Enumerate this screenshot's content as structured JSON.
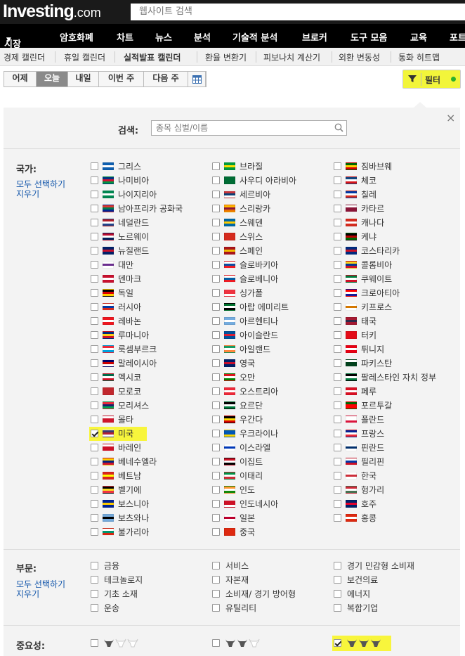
{
  "header": {
    "logo_text": "Investing",
    "logo_suffix": ".com",
    "search_placeholder": "웹사이트 검색"
  },
  "nav": [
    {
      "label": "시장",
      "has_caret": true
    },
    {
      "label": "암호화폐"
    },
    {
      "label": "차트"
    },
    {
      "label": "뉴스"
    },
    {
      "label": "분석"
    },
    {
      "label": "기술적 분석"
    },
    {
      "label": "브로커"
    },
    {
      "label": "도구 모음"
    },
    {
      "label": "교육"
    },
    {
      "label": "포트"
    }
  ],
  "subnav": [
    "경제 캘린더",
    "휴일 캘린더",
    "실적발표 캘린더",
    "환율 변환기",
    "피보나치 계산기",
    "외환 변동성",
    "통화 히트맵"
  ],
  "day_tabs": [
    {
      "label": "어제"
    },
    {
      "label": "오늘",
      "active": true
    },
    {
      "label": "내일"
    },
    {
      "label": "이번 주"
    },
    {
      "label": "다음 주"
    }
  ],
  "filter": {
    "label": "필터",
    "active": true
  },
  "search": {
    "label": "검색:",
    "placeholder": "종목 심벌/이름"
  },
  "country_section": {
    "title": "국가:",
    "select_all": "모두 선택하기",
    "clear": "지우기"
  },
  "countries": [
    [
      {
        "name": "그리스",
        "checked": false,
        "colors": [
          "#0d5eaf",
          "#ffffff",
          "#0d5eaf"
        ]
      },
      {
        "name": "나미비아",
        "checked": false,
        "colors": [
          "#003580",
          "#d21034",
          "#009543"
        ]
      },
      {
        "name": "나이지리아",
        "checked": false,
        "colors": [
          "#008751",
          "#ffffff",
          "#008751"
        ]
      },
      {
        "name": "남아프리카 공화국",
        "checked": false,
        "colors": [
          "#de3831",
          "#007a4d",
          "#002395"
        ]
      },
      {
        "name": "네덜란드",
        "checked": false,
        "colors": [
          "#ae1c28",
          "#ffffff",
          "#21468b"
        ]
      },
      {
        "name": "노르웨이",
        "checked": false,
        "colors": [
          "#ba0c2f",
          "#ffffff",
          "#00205b"
        ]
      },
      {
        "name": "뉴질랜드",
        "checked": false,
        "colors": [
          "#012169",
          "#c8102e",
          "#012169"
        ]
      },
      {
        "name": "대만",
        "checked": false,
        "colors": [
          "#ffffff",
          "#6b2d8f",
          "#ffffff"
        ]
      },
      {
        "name": "덴마크",
        "checked": false,
        "colors": [
          "#c8102e",
          "#ffffff",
          "#c8102e"
        ]
      },
      {
        "name": "독일",
        "checked": false,
        "colors": [
          "#000000",
          "#dd0000",
          "#ffce00"
        ]
      },
      {
        "name": "러시아",
        "checked": false,
        "colors": [
          "#ffffff",
          "#0039a6",
          "#d52b1e"
        ]
      },
      {
        "name": "레바논",
        "checked": false,
        "colors": [
          "#ee161f",
          "#ffffff",
          "#ee161f"
        ]
      },
      {
        "name": "루마니아",
        "checked": false,
        "colors": [
          "#002b7f",
          "#fcd116",
          "#ce1126"
        ]
      },
      {
        "name": "룩셈부르크",
        "checked": false,
        "colors": [
          "#ed2939",
          "#ffffff",
          "#00a1de"
        ]
      },
      {
        "name": "말레이시아",
        "checked": false,
        "colors": [
          "#010066",
          "#cc0001",
          "#ffffff"
        ]
      },
      {
        "name": "멕시코",
        "checked": false,
        "colors": [
          "#006847",
          "#ffffff",
          "#ce1126"
        ]
      },
      {
        "name": "모로코",
        "checked": false,
        "colors": [
          "#c1272d",
          "#c1272d",
          "#c1272d"
        ]
      },
      {
        "name": "모리셔스",
        "checked": false,
        "colors": [
          "#ea2839",
          "#1a206d",
          "#00a551"
        ]
      },
      {
        "name": "몰타",
        "checked": false,
        "colors": [
          "#ffffff",
          "#cf142b",
          "#cf142b"
        ]
      },
      {
        "name": "미국",
        "checked": true,
        "colors": [
          "#3c3b6e",
          "#b22234",
          "#ffffff"
        ]
      },
      {
        "name": "바레인",
        "checked": false,
        "colors": [
          "#ffffff",
          "#ce1126",
          "#ce1126"
        ]
      },
      {
        "name": "베네수엘라",
        "checked": false,
        "colors": [
          "#ffcc00",
          "#00247d",
          "#cf142b"
        ]
      },
      {
        "name": "베트남",
        "checked": false,
        "colors": [
          "#da251d",
          "#ffff00",
          "#da251d"
        ]
      },
      {
        "name": "벨기에",
        "checked": false,
        "colors": [
          "#000000",
          "#fdda24",
          "#ef3340"
        ]
      },
      {
        "name": "보스니아",
        "checked": false,
        "colors": [
          "#002395",
          "#fecb00",
          "#002395"
        ]
      },
      {
        "name": "보츠와나",
        "checked": false,
        "colors": [
          "#75aadb",
          "#000000",
          "#75aadb"
        ]
      },
      {
        "name": "불가리아",
        "checked": false,
        "colors": [
          "#ffffff",
          "#00966e",
          "#d62612"
        ]
      }
    ],
    [
      {
        "name": "브라질",
        "checked": false,
        "colors": [
          "#009c3b",
          "#ffdf00",
          "#009c3b"
        ]
      },
      {
        "name": "사우디 아라비아",
        "checked": false,
        "colors": [
          "#006c35",
          "#006c35",
          "#006c35"
        ]
      },
      {
        "name": "세르비아",
        "checked": false,
        "colors": [
          "#c6363c",
          "#0c4076",
          "#ffffff"
        ]
      },
      {
        "name": "스리랑카",
        "checked": false,
        "colors": [
          "#ffb700",
          "#8d153a",
          "#eb7400"
        ]
      },
      {
        "name": "스웨덴",
        "checked": false,
        "colors": [
          "#006aa7",
          "#fecc00",
          "#006aa7"
        ]
      },
      {
        "name": "스위스",
        "checked": false,
        "colors": [
          "#d52b1e",
          "#d52b1e",
          "#d52b1e"
        ]
      },
      {
        "name": "스페인",
        "checked": false,
        "colors": [
          "#aa151b",
          "#f1bf00",
          "#aa151b"
        ]
      },
      {
        "name": "슬로바키아",
        "checked": false,
        "colors": [
          "#ffffff",
          "#0b4ea2",
          "#ee1c25"
        ]
      },
      {
        "name": "슬로베니아",
        "checked": false,
        "colors": [
          "#ffffff",
          "#005da4",
          "#ed1c24"
        ]
      },
      {
        "name": "싱가폴",
        "checked": false,
        "colors": [
          "#ef3340",
          "#ef3340",
          "#ffffff"
        ]
      },
      {
        "name": "아랍 에미리트",
        "checked": false,
        "colors": [
          "#00732f",
          "#ffffff",
          "#000000"
        ]
      },
      {
        "name": "아르헨티나",
        "checked": false,
        "colors": [
          "#74acdf",
          "#ffffff",
          "#74acdf"
        ]
      },
      {
        "name": "아이슬란드",
        "checked": false,
        "colors": [
          "#02529c",
          "#dc1e35",
          "#02529c"
        ]
      },
      {
        "name": "아일랜드",
        "checked": false,
        "colors": [
          "#169b62",
          "#ffffff",
          "#ff883e"
        ]
      },
      {
        "name": "영국",
        "checked": false,
        "colors": [
          "#012169",
          "#c8102e",
          "#012169"
        ]
      },
      {
        "name": "오만",
        "checked": false,
        "colors": [
          "#db161b",
          "#ffffff",
          "#008000"
        ]
      },
      {
        "name": "오스트리아",
        "checked": false,
        "colors": [
          "#ed2939",
          "#ffffff",
          "#ed2939"
        ]
      },
      {
        "name": "요르단",
        "checked": false,
        "colors": [
          "#000000",
          "#ffffff",
          "#007a3d"
        ]
      },
      {
        "name": "우간다",
        "checked": false,
        "colors": [
          "#000000",
          "#fcdc04",
          "#d90000"
        ]
      },
      {
        "name": "우크라이나",
        "checked": false,
        "colors": [
          "#0057b7",
          "#0057b7",
          "#ffd700"
        ]
      },
      {
        "name": "이스라엘",
        "checked": false,
        "colors": [
          "#ffffff",
          "#0038b8",
          "#ffffff"
        ]
      },
      {
        "name": "이집트",
        "checked": false,
        "colors": [
          "#ce1126",
          "#ffffff",
          "#000000"
        ]
      },
      {
        "name": "이태리",
        "checked": false,
        "colors": [
          "#009246",
          "#ffffff",
          "#ce2b37"
        ]
      },
      {
        "name": "인도",
        "checked": false,
        "colors": [
          "#ff9933",
          "#ffffff",
          "#138808"
        ]
      },
      {
        "name": "인도네시아",
        "checked": false,
        "colors": [
          "#ce1126",
          "#ce1126",
          "#ffffff"
        ]
      },
      {
        "name": "일본",
        "checked": false,
        "colors": [
          "#ffffff",
          "#bc002d",
          "#ffffff"
        ]
      },
      {
        "name": "중국",
        "checked": false,
        "colors": [
          "#de2910",
          "#de2910",
          "#de2910"
        ]
      }
    ],
    [
      {
        "name": "짐바브웨",
        "checked": false,
        "colors": [
          "#006400",
          "#ffd200",
          "#d40000"
        ]
      },
      {
        "name": "체코",
        "checked": false,
        "colors": [
          "#11457e",
          "#ffffff",
          "#d7141a"
        ]
      },
      {
        "name": "칠레",
        "checked": false,
        "colors": [
          "#0039a6",
          "#ffffff",
          "#d52b1e"
        ]
      },
      {
        "name": "카타르",
        "checked": false,
        "colors": [
          "#ffffff",
          "#8a1538",
          "#8a1538"
        ]
      },
      {
        "name": "캐나다",
        "checked": false,
        "colors": [
          "#d52b1e",
          "#ffffff",
          "#d52b1e"
        ]
      },
      {
        "name": "케냐",
        "checked": false,
        "colors": [
          "#000000",
          "#bb0000",
          "#006600"
        ]
      },
      {
        "name": "코스타리카",
        "checked": false,
        "colors": [
          "#002b7f",
          "#ce1126",
          "#002b7f"
        ]
      },
      {
        "name": "콜롬비아",
        "checked": false,
        "colors": [
          "#fcd116",
          "#003893",
          "#ce1126"
        ]
      },
      {
        "name": "쿠웨이트",
        "checked": false,
        "colors": [
          "#007a3d",
          "#ffffff",
          "#ce1126"
        ]
      },
      {
        "name": "크로아티아",
        "checked": false,
        "colors": [
          "#ff0000",
          "#ffffff",
          "#171796"
        ]
      },
      {
        "name": "키프로스",
        "checked": false,
        "colors": [
          "#ffffff",
          "#d57800",
          "#ffffff"
        ]
      },
      {
        "name": "태국",
        "checked": false,
        "colors": [
          "#a51931",
          "#2d2a4a",
          "#a51931"
        ]
      },
      {
        "name": "터키",
        "checked": false,
        "colors": [
          "#e30a17",
          "#e30a17",
          "#e30a17"
        ]
      },
      {
        "name": "튀니지",
        "checked": false,
        "colors": [
          "#e70013",
          "#ffffff",
          "#e70013"
        ]
      },
      {
        "name": "파키스탄",
        "checked": false,
        "colors": [
          "#ffffff",
          "#01411c",
          "#01411c"
        ]
      },
      {
        "name": "팔레스타인 자치 정부",
        "checked": false,
        "colors": [
          "#000000",
          "#ffffff",
          "#007a3d"
        ]
      },
      {
        "name": "페루",
        "checked": false,
        "colors": [
          "#d91023",
          "#ffffff",
          "#d91023"
        ]
      },
      {
        "name": "포르투갈",
        "checked": false,
        "colors": [
          "#006600",
          "#ff0000",
          "#ff0000"
        ]
      },
      {
        "name": "폴란드",
        "checked": false,
        "colors": [
          "#ffffff",
          "#ffffff",
          "#dc143c"
        ]
      },
      {
        "name": "프랑스",
        "checked": false,
        "colors": [
          "#002395",
          "#ffffff",
          "#ed2939"
        ]
      },
      {
        "name": "핀란드",
        "checked": false,
        "colors": [
          "#ffffff",
          "#002f6c",
          "#ffffff"
        ]
      },
      {
        "name": "필리핀",
        "checked": false,
        "colors": [
          "#ffffff",
          "#0038a8",
          "#ce1126"
        ]
      },
      {
        "name": "한국",
        "checked": false,
        "colors": [
          "#ffffff",
          "#cd2e3a",
          "#ffffff"
        ]
      },
      {
        "name": "헝가리",
        "checked": false,
        "colors": [
          "#ce2939",
          "#ffffff",
          "#477050"
        ]
      },
      {
        "name": "호주",
        "checked": false,
        "colors": [
          "#012169",
          "#e4002b",
          "#012169"
        ]
      },
      {
        "name": "홍콩",
        "checked": false,
        "colors": [
          "#de2910",
          "#ffffff",
          "#de2910"
        ]
      }
    ]
  ],
  "sector_section": {
    "title": "부문:",
    "select_all": "모두 선택하기",
    "clear": "지우기"
  },
  "sectors": [
    [
      "금융",
      "테크놀로지",
      "기초 소재",
      "운송"
    ],
    [
      "서비스",
      "자본재",
      "소비재/ 경기 방어형",
      "유틸리티"
    ],
    [
      "경기 민감형 소비재",
      "보건의료",
      "에너지",
      "복합기업"
    ]
  ],
  "importance_section": {
    "title": "중요성:",
    "levels": [
      {
        "level": 1,
        "checked": false
      },
      {
        "level": 2,
        "checked": false
      },
      {
        "level": 3,
        "checked": true
      }
    ]
  },
  "colors": {
    "highlight": "#f8f53c",
    "link": "#1155aa",
    "active_dot": "#2cb12c"
  }
}
